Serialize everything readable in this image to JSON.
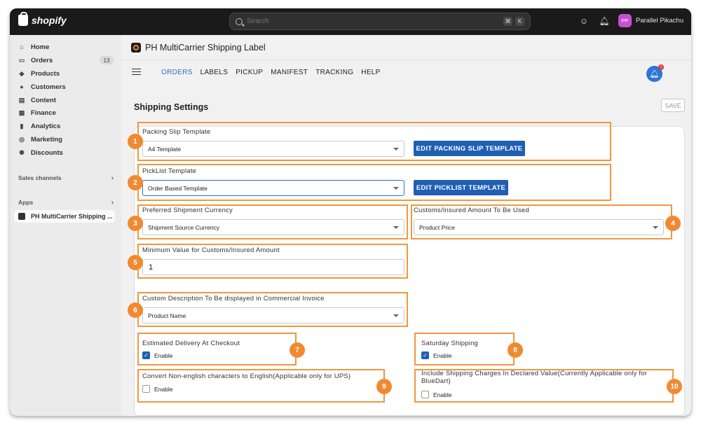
{
  "topbar": {
    "brand": "shopify",
    "search_placeholder": "Search",
    "kbd1": "⌘",
    "kbd2": "K",
    "user_initials": "PP",
    "user_name": "Parallel Pikachu"
  },
  "sidebar": {
    "items": [
      {
        "label": "Home",
        "icon": "home-icon"
      },
      {
        "label": "Orders",
        "icon": "orders-icon",
        "badge": "13"
      },
      {
        "label": "Products",
        "icon": "tag-icon"
      },
      {
        "label": "Customers",
        "icon": "person-icon"
      },
      {
        "label": "Content",
        "icon": "content-icon"
      },
      {
        "label": "Finance",
        "icon": "bank-icon"
      },
      {
        "label": "Analytics",
        "icon": "chart-icon"
      },
      {
        "label": "Marketing",
        "icon": "target-icon"
      },
      {
        "label": "Discounts",
        "icon": "discount-icon"
      }
    ],
    "sales_channels": "Sales channels",
    "apps": "Apps",
    "app_item": "PH MultiCarrier Shipping ..."
  },
  "app": {
    "title": "PH MultiCarrier Shipping Label",
    "tabs": [
      "ORDERS",
      "LABELS",
      "PICKUP",
      "MANIFEST",
      "TRACKING",
      "HELP"
    ],
    "bell_count": "1",
    "page_title": "Shipping Settings",
    "save_label": "SAVE"
  },
  "fields": {
    "packing_slip": {
      "label": "Packing Slip Template",
      "value": "A4 Template",
      "button": "EDIT PACKING SLIP TEMPLATE",
      "num": "1"
    },
    "picklist": {
      "label": "PickList Template",
      "value": "Order Based Template",
      "button": "EDIT PICKLIST TEMPLATE",
      "num": "2"
    },
    "currency": {
      "label": "Preferred Shipment Currency",
      "value": "Shipment Source Currency",
      "num": "3"
    },
    "customs_amount": {
      "label": "Customs/Insured Amount To Be Used",
      "value": "Product Price",
      "num": "4"
    },
    "min_value": {
      "label": "Minimum Value for Customs/Insured Amount",
      "value": "1",
      "num": "5"
    },
    "custom_desc": {
      "label": "Custom Description To Be displayed in Commercial Invoice",
      "value": "Product Name",
      "num": "6"
    },
    "est_delivery": {
      "label": "Estimated Delivery At Checkout",
      "check": "Enable",
      "num": "7"
    },
    "saturday": {
      "label": "Saturday Shipping",
      "check": "Enable",
      "num": "8"
    },
    "non_english": {
      "label": "Convert Non-english characters to English(Applicable only for UPS)",
      "check": "Enable",
      "num": "9"
    },
    "shipping_charges": {
      "label_line1": "Include Shipping Charges In Declared Value(Currently Applicable only for",
      "label_line2": "BlueDart)",
      "check": "Enable",
      "num": "10"
    }
  }
}
